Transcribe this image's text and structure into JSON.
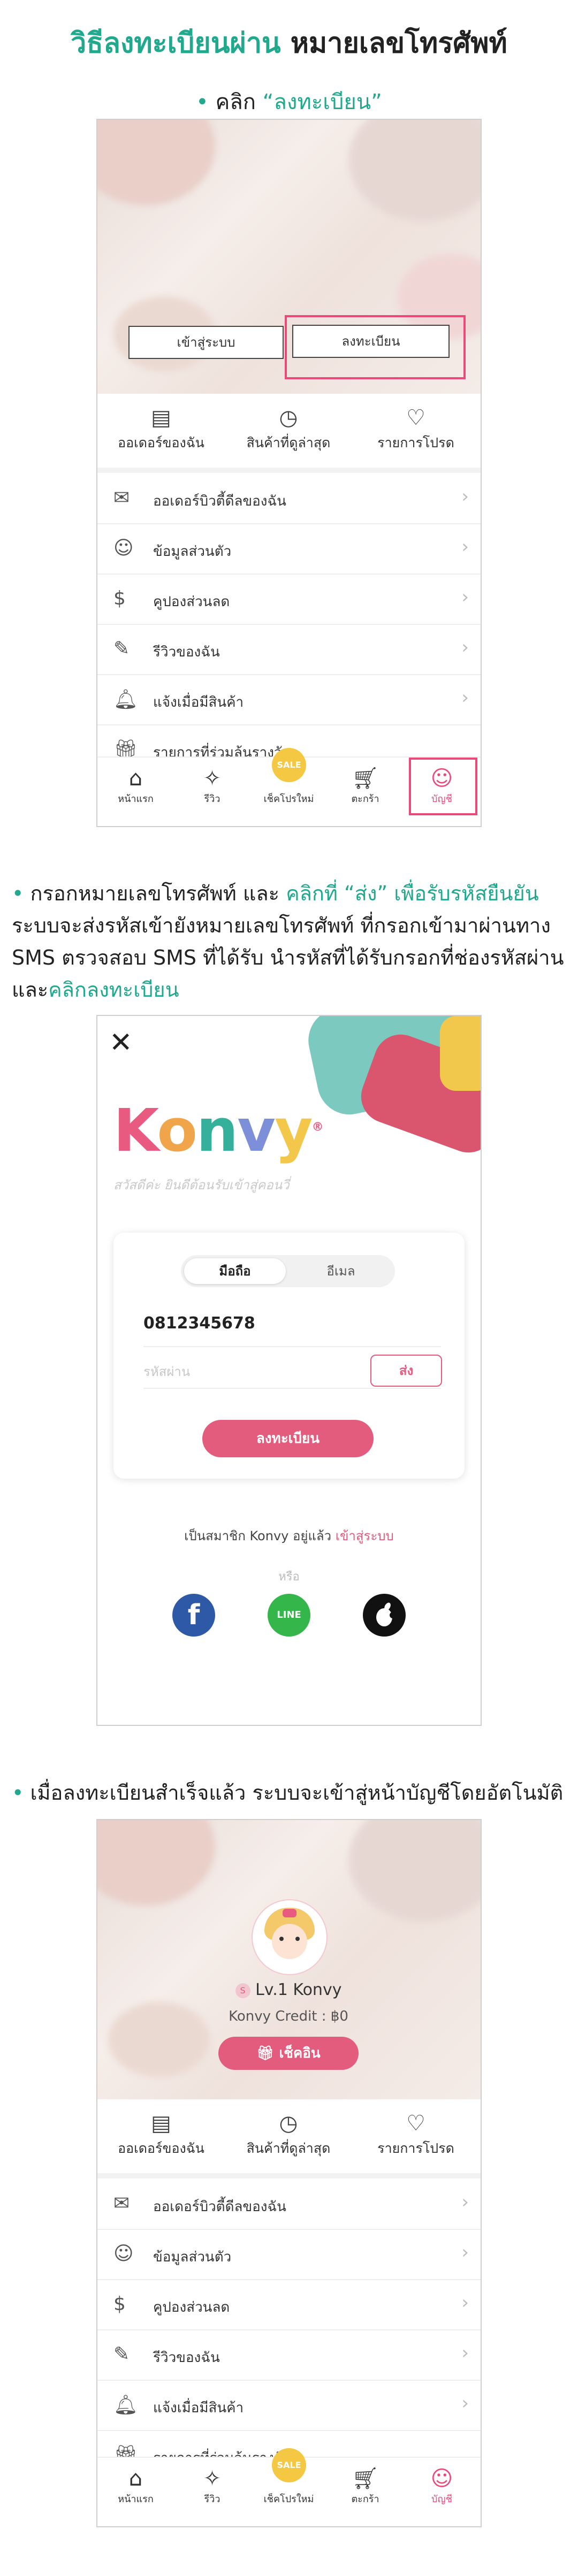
{
  "title": {
    "part1": "วิธีลงทะเบียนผ่าน",
    "part2": "หมายเลขโทรศัพท์"
  },
  "step1": {
    "bullet": "•",
    "label": "คลิก",
    "quote": "“ลงทะเบียน”"
  },
  "account": {
    "login_btn": "เข้าสู่ระบบ",
    "register_btn": "ลงทะเบียน",
    "stats": [
      {
        "icon": "orders-icon",
        "glyph": "▤",
        "label": "ออเดอร์ของฉัน"
      },
      {
        "icon": "history-icon",
        "glyph": "◷",
        "label": "สินค้าที่ดูล่าสุด"
      },
      {
        "icon": "heart-icon",
        "glyph": "♡",
        "label": "รายการโปรด"
      }
    ],
    "menu": [
      {
        "icon": "mail-icon",
        "glyph": "✉",
        "label": "ออเดอร์บิวตี้ดีลของฉัน"
      },
      {
        "icon": "user-icon",
        "glyph": "☺",
        "label": "ข้อมูลส่วนตัว"
      },
      {
        "icon": "coupon-icon",
        "glyph": "$",
        "label": "คูปองส่วนลด"
      },
      {
        "icon": "edit-icon",
        "glyph": "✎",
        "label": "รีวิวของฉัน"
      },
      {
        "icon": "bell-icon",
        "glyph": "🔔︎",
        "label": "แจ้งเมื่อมีสินค้า"
      },
      {
        "icon": "gift-icon",
        "glyph": "🎁︎",
        "label": "รายการที่ร่วมลุ้นรางวัล"
      }
    ],
    "tabs": [
      {
        "icon": "home-icon",
        "glyph": "⌂",
        "label": "หน้าแรก"
      },
      {
        "icon": "review-icon",
        "glyph": "✧",
        "label": "รีวิว"
      },
      {
        "icon": "sale-icon",
        "glyph": "SALE",
        "label": "เช็คโปรใหม่"
      },
      {
        "icon": "cart-icon",
        "glyph": "🛒︎",
        "label": "ตะกร้า"
      },
      {
        "icon": "account-icon",
        "glyph": "☺",
        "label": "บัญชี"
      }
    ]
  },
  "step2": {
    "bullet": "•",
    "s1": "กรอกหมายเลขโทรศัพท์",
    "s2": " และ",
    "s3": "คลิกที่ “ส่ง” เพื่อรับรหัสยืนยัน",
    "s4": "ระบบจะส่งรหัสเข้ายังหมายเลขโทรศัพท์ ที่กรอกเข้ามาผ่านทาง SMS ตรวจสอบ SMS ที่ได้รับ นำรหัสที่ได้รับกรอกที่ช่องรหัสผ่าน",
    "s5": " และ",
    "s6": "คลิกลงทะเบียน"
  },
  "register": {
    "close": "✕",
    "logo": {
      "k": "K",
      "o": "o",
      "n": "n",
      "v": "v",
      "y": "y",
      "tm": "®"
    },
    "greeting": "สวัสดีค่ะ ยินดีต้อนรับเข้าสู่คอนวี่",
    "tab_phone": "มือถือ",
    "tab_email": "อีเมล",
    "phone_value": "0812345678",
    "password_placeholder": "รหัสผ่าน",
    "send_btn": "ส่ง",
    "register_btn": "ลงทะเบียน",
    "member_text": "เป็นสมาชิก Konvy อยู่แล้ว",
    "login_link": "เข้าสู่ระบบ",
    "or": "หรือ",
    "social": {
      "facebook": "f",
      "line": "LINE",
      "apple": ""
    }
  },
  "step3": {
    "bullet": "•",
    "text": "เมื่อลงทะเบียนสำเร็จแล้ว ระบบจะเข้าสู่หน้าบัญชีโดยอัตโนมัติ"
  },
  "profile": {
    "level": "Lv.1",
    "name": "Konvy",
    "credit": "Konvy Credit : ฿0",
    "checkin": "เช็คอิน",
    "badge": "S"
  },
  "colors": {
    "teal": "#21a88d",
    "pink": "#e94a7a",
    "brand_pink": "#e35b7d"
  }
}
